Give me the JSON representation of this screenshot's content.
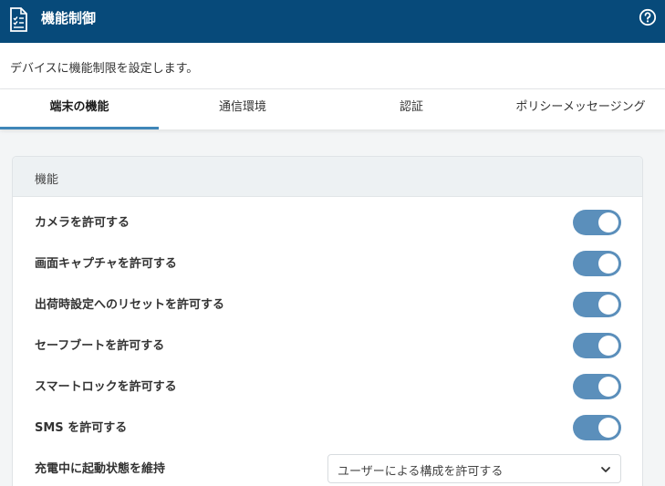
{
  "header": {
    "title": "機能制御",
    "doc_icon": "document-checklist-icon",
    "help_icon": "help-circle-icon",
    "bg_color": "#074a7a"
  },
  "description": "デバイスに機能制限を設定します。",
  "tabs": [
    {
      "label": "端末の機能",
      "active": true
    },
    {
      "label": "通信環境",
      "active": false
    },
    {
      "label": "認証",
      "active": false
    },
    {
      "label": "ポリシーメッセージング",
      "active": false
    }
  ],
  "panel": {
    "title": "機能",
    "rows": [
      {
        "label": "カメラを許可する",
        "type": "toggle",
        "on": true
      },
      {
        "label": "画面キャプチャを許可する",
        "type": "toggle",
        "on": true
      },
      {
        "label": "出荷時設定へのリセットを許可する",
        "type": "toggle",
        "on": true
      },
      {
        "label": "セーフブートを許可する",
        "type": "toggle",
        "on": true
      },
      {
        "label": "スマートロックを許可する",
        "type": "toggle",
        "on": true
      },
      {
        "label": "SMS を許可する",
        "type": "toggle",
        "on": true
      },
      {
        "label": "充電中に起動状態を維持",
        "type": "select",
        "value": "ユーザーによる構成を許可する"
      }
    ]
  },
  "colors": {
    "accent": "#3f86b8",
    "toggle_on": "#5b8fbb"
  }
}
